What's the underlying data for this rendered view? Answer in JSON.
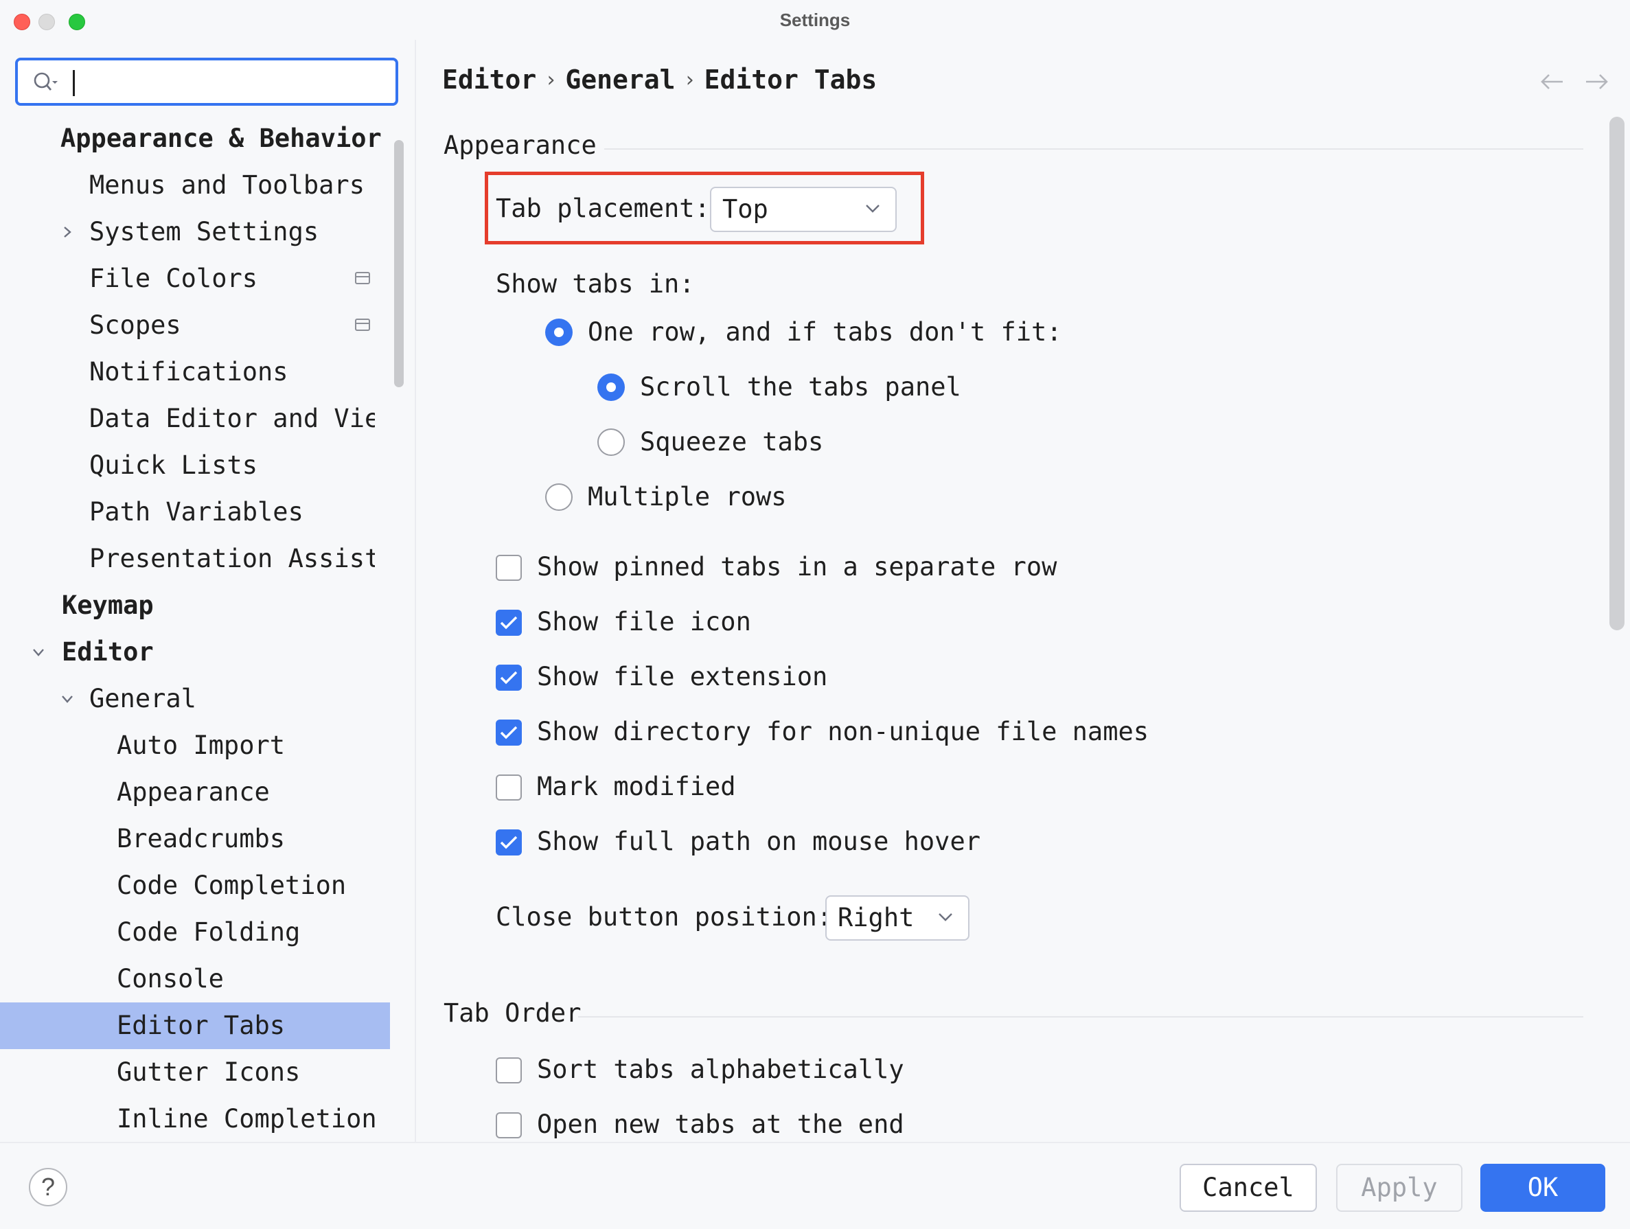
{
  "window": {
    "title": "Settings"
  },
  "sidebar": {
    "search": {
      "value": "",
      "placeholder": ""
    },
    "items": [
      {
        "label": "Appearance & Behavior"
      },
      {
        "label": "Menus and Toolbars"
      },
      {
        "label": "System Settings"
      },
      {
        "label": "File Colors"
      },
      {
        "label": "Scopes"
      },
      {
        "label": "Notifications"
      },
      {
        "label": "Data Editor and View"
      },
      {
        "label": "Quick Lists"
      },
      {
        "label": "Path Variables"
      },
      {
        "label": "Presentation Assistant"
      },
      {
        "label": "Keymap"
      },
      {
        "label": "Editor"
      },
      {
        "label": "General"
      },
      {
        "label": "Auto Import"
      },
      {
        "label": "Appearance"
      },
      {
        "label": "Breadcrumbs"
      },
      {
        "label": "Code Completion"
      },
      {
        "label": "Code Folding"
      },
      {
        "label": "Console"
      },
      {
        "label": "Editor Tabs"
      },
      {
        "label": "Gutter Icons"
      },
      {
        "label": "Inline Completion"
      }
    ]
  },
  "breadcrumb": {
    "items": [
      "Editor",
      "General",
      "Editor Tabs"
    ],
    "separator": "›"
  },
  "appearance": {
    "title": "Appearance",
    "tab_placement_label": "Tab placement:",
    "tab_placement_value": "Top",
    "show_tabs_in_label": "Show tabs in:",
    "one_row": "One row, and if tabs don't fit:",
    "scroll_panel": "Scroll the tabs panel",
    "squeeze_tabs": "Squeeze tabs",
    "multiple_rows": "Multiple rows",
    "checkboxes": [
      {
        "label": "Show pinned tabs in a separate row",
        "checked": false
      },
      {
        "label": "Show file icon",
        "checked": true
      },
      {
        "label": "Show file extension",
        "checked": true
      },
      {
        "label": "Show directory for non-unique file names",
        "checked": true
      },
      {
        "label": "Mark modified",
        "checked": false
      },
      {
        "label": "Show full path on mouse hover",
        "checked": true
      }
    ],
    "close_button_label": "Close button position:",
    "close_button_value": "Right"
  },
  "tab_order": {
    "title": "Tab Order",
    "checkboxes": [
      {
        "label": "Sort tabs alphabetically",
        "checked": false
      },
      {
        "label": "Open new tabs at the end",
        "checked": false
      }
    ]
  },
  "footer": {
    "help": "?",
    "cancel": "Cancel",
    "apply": "Apply",
    "ok": "OK"
  },
  "colors": {
    "accent": "#3574f0",
    "selection": "#a7bdf2",
    "highlight": "#e53d2c"
  }
}
